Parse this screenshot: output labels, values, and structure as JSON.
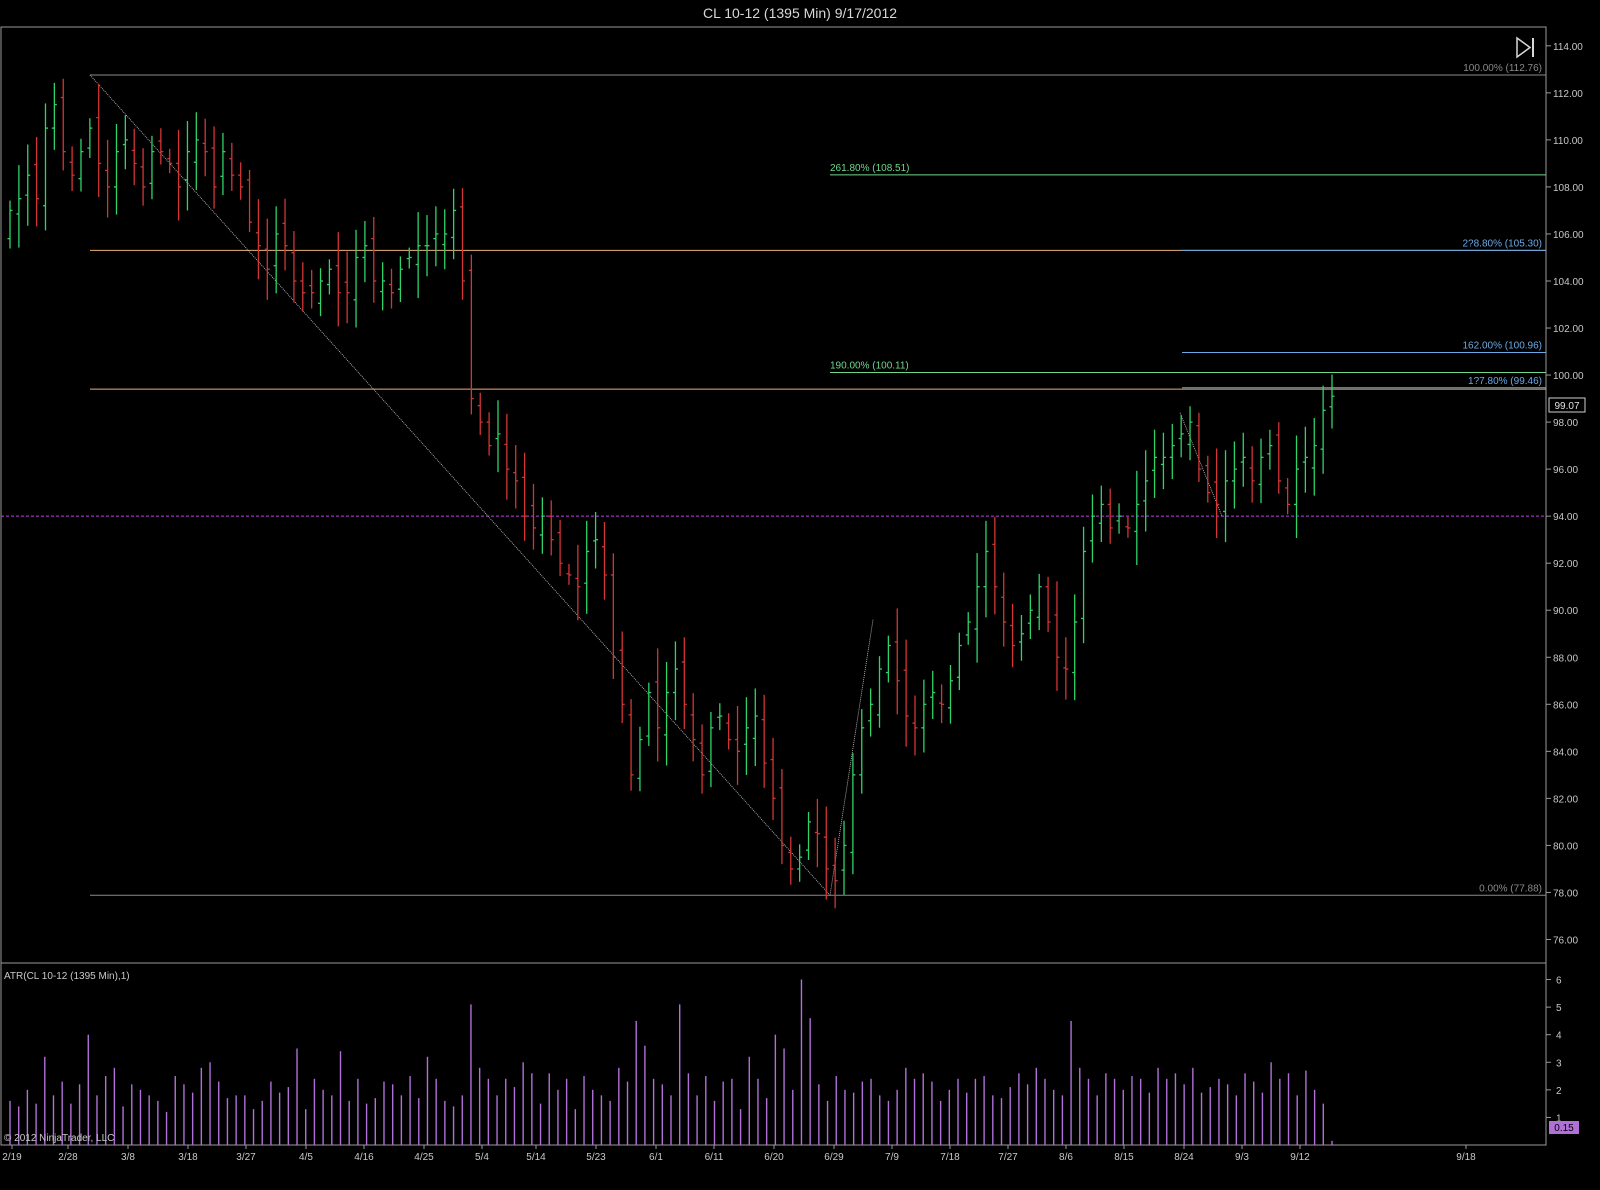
{
  "window": {
    "title": "CL 10-12 (1395 Min)  9/17/2012"
  },
  "colors": {
    "up_bar": "#2fd36a",
    "down_bar": "#d43535",
    "atr": "#b070d8",
    "orange": "#e6b27a",
    "green_fib": "#6fd68c",
    "blue_fib": "#6aa9e6",
    "gray_fib": "#8a8a8a",
    "magenta": "#c040e0",
    "axis_text": "#c8c8c8"
  },
  "chart_data": [
    {
      "type": "ohlc",
      "title": "CL 10-12 (1395 Min)  9/17/2012",
      "ylim": [
        75,
        114.8
      ],
      "y_ticks": [
        "114.00",
        "112.00",
        "110.00",
        "108.00",
        "106.00",
        "104.00",
        "102.00",
        "100.00",
        "98.00",
        "96.00",
        "94.00",
        "92.00",
        "90.00",
        "88.00",
        "86.00",
        "84.00",
        "82.00",
        "80.00",
        "78.00",
        "76.00"
      ],
      "x_ticks": [
        "2/19",
        "2/28",
        "3/8",
        "3/18",
        "3/27",
        "4/5",
        "4/16",
        "4/25",
        "5/4",
        "5/14",
        "5/23",
        "6/1",
        "6/11",
        "6/20",
        "6/29",
        "7/9",
        "7/18",
        "7/27",
        "8/6",
        "8/15",
        "8/24",
        "9/3",
        "9/12",
        "9/18"
      ],
      "last_price": "99.07",
      "hlines": [
        {
          "value": 112.76,
          "color": "gray",
          "label": "100.00% (112.76)"
        },
        {
          "value": 108.51,
          "color": "green",
          "label": "261.80% (108.51)"
        },
        {
          "value": 105.3,
          "color": "orange",
          "label": ""
        },
        {
          "value": 105.3,
          "color": "blue",
          "label": "2?8.80% (105.30)"
        },
        {
          "value": 100.96,
          "color": "blue",
          "label": "162.00% (100.96)"
        },
        {
          "value": 100.11,
          "color": "green",
          "label": "190.00% (100.11)"
        },
        {
          "value": 99.4,
          "color": "orange",
          "label": ""
        },
        {
          "value": 99.46,
          "color": "blue",
          "label": "1?7.80% (99.46)"
        },
        {
          "value": 94.0,
          "color": "magenta",
          "label": ""
        },
        {
          "value": 77.88,
          "color": "gray",
          "label": "0.00% (77.88)"
        }
      ],
      "close_path": [
        107.0,
        107.5,
        108.5,
        107.5,
        110.5,
        111.5,
        109.5,
        108.5,
        109.5,
        110.5,
        109.0,
        108.0,
        109.5,
        110.0,
        109.0,
        108.0,
        109.5,
        109.5,
        109.0,
        108.0,
        109.5,
        110.0,
        109.5,
        108.0,
        109.5,
        108.5,
        108.0,
        106.5,
        105.5,
        104.5,
        106.0,
        105.5,
        104.0,
        103.5,
        103.5,
        104.0,
        104.5,
        103.5,
        103.5,
        105.0,
        105.5,
        104.0,
        104.0,
        103.5,
        104.5,
        105.0,
        105.5,
        105.5,
        106.0,
        106.0,
        107.0,
        104.0,
        99.0,
        98.0,
        97.0,
        97.5,
        96.0,
        95.5,
        94.0,
        93.5,
        94.0,
        93.0,
        92.0,
        91.5,
        91.0,
        92.5,
        93.0,
        91.5,
        88.0,
        86.0,
        83.0,
        84.5,
        86.5,
        85.0,
        86.5,
        87.5,
        86.0,
        84.5,
        83.0,
        85.0,
        85.5,
        84.5,
        84.0,
        85.0,
        85.5,
        83.5,
        82.0,
        80.0,
        79.0,
        79.5,
        81.0,
        80.5,
        79.0,
        78.5,
        80.0,
        83.0,
        85.0,
        86.0,
        87.5,
        88.5,
        87.0,
        85.5,
        85.0,
        86.0,
        86.5,
        86.0,
        87.0,
        88.5,
        89.5,
        91.0,
        92.5,
        91.0,
        89.5,
        88.5,
        89.0,
        90.0,
        91.0,
        89.5,
        88.0,
        87.5,
        89.5,
        92.5,
        94.0,
        94.5,
        93.5,
        94.0,
        93.5,
        94.5,
        95.5,
        96.5,
        96.5,
        97.0,
        97.5,
        98.0,
        96.0,
        95.0,
        94.5,
        95.5,
        96.0,
        96.5,
        95.5,
        96.5,
        97.0,
        95.5,
        94.5,
        96.0,
        96.5,
        97.0,
        98.5,
        99.1
      ],
      "atr": {
        "label": "ATR(CL 10-12 (1395 Min),1)",
        "ylim": [
          0,
          6.6
        ],
        "y_ticks": [
          "6",
          "5",
          "4",
          "3",
          "2",
          "1"
        ],
        "last_value": "0.15",
        "values": [
          1.6,
          1.4,
          2.0,
          1.5,
          3.2,
          1.8,
          2.3,
          1.5,
          2.2,
          4.0,
          1.8,
          2.5,
          2.8,
          1.4,
          2.2,
          2.0,
          1.8,
          1.6,
          1.2,
          2.5,
          2.2,
          1.9,
          2.8,
          3.0,
          2.3,
          1.7,
          1.8,
          1.8,
          1.3,
          1.6,
          2.3,
          1.9,
          2.1,
          3.5,
          1.3,
          2.4,
          2.0,
          1.8,
          3.4,
          1.6,
          2.4,
          1.5,
          1.7,
          2.3,
          2.2,
          1.8,
          2.5,
          1.7,
          3.2,
          2.4,
          1.6,
          1.4,
          1.8,
          5.1,
          2.8,
          2.4,
          1.8,
          2.4,
          2.1,
          3.0,
          2.6,
          1.5,
          2.6,
          2.0,
          2.4,
          1.3,
          2.5,
          2.0,
          1.8,
          1.6,
          2.8,
          2.3,
          4.5,
          3.6,
          2.4,
          2.2,
          1.8,
          5.1,
          2.6,
          1.8,
          2.5,
          1.6,
          2.3,
          2.4,
          1.3,
          3.2,
          2.4,
          1.7,
          4.0,
          3.5,
          2.0,
          6.0,
          4.6,
          2.2,
          1.6,
          2.5,
          2.0,
          1.9,
          2.3,
          2.4,
          1.8,
          1.6,
          2.0,
          2.8,
          2.4,
          2.6,
          2.3,
          1.6,
          2.0,
          2.4,
          1.9,
          2.4,
          2.5,
          1.8,
          1.7,
          2.1,
          2.6,
          2.2,
          2.8,
          2.4,
          2.0,
          1.8,
          4.5,
          2.8,
          2.4,
          1.8,
          2.6,
          2.4,
          2.0,
          2.5,
          2.4,
          1.9,
          2.8,
          2.4,
          2.6,
          2.2,
          2.8,
          1.9,
          2.1,
          2.4,
          2.2,
          1.8,
          2.6,
          2.3,
          1.9,
          3.0,
          2.4,
          2.6,
          1.8,
          2.7,
          2.0,
          1.5,
          0.15
        ]
      }
    }
  ],
  "footer": {
    "copyright": "© 2012 NinjaTrader, LLC"
  },
  "icons": {
    "scroll_end": "skip-to-end-icon"
  }
}
